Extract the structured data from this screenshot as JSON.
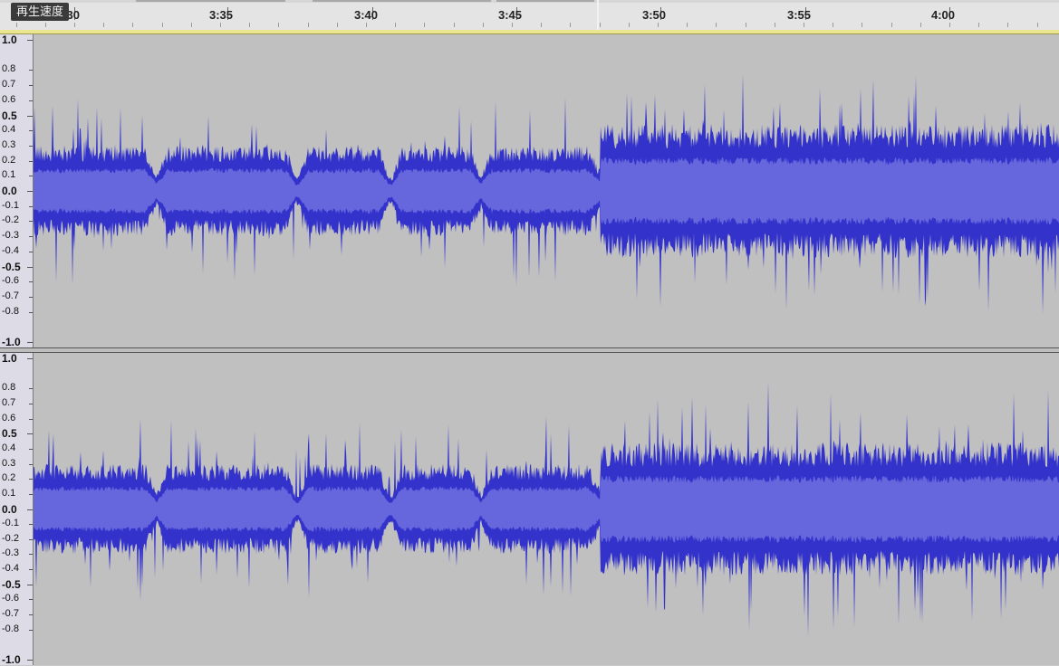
{
  "tooltip": "再生速度",
  "timeline": {
    "labels": [
      "3:30",
      "3:35",
      "3:40",
      "3:45",
      "3:50",
      "3:55",
      "4:00"
    ]
  },
  "tracks": [
    {
      "name": "left-channel",
      "scale_labels": [
        "1.0",
        "0.8",
        "0.7",
        "0.6",
        "0.5",
        "0.4",
        "0.3",
        "0.2",
        "0.1",
        "0.0",
        "-0.1",
        "-0.2",
        "-0.3",
        "-0.4",
        "-0.5",
        "-0.6",
        "-0.7",
        "-0.8",
        "-1.0"
      ]
    },
    {
      "name": "right-channel",
      "scale_labels": [
        "1.0",
        "0.8",
        "0.7",
        "0.6",
        "0.5",
        "0.4",
        "0.3",
        "0.2",
        "0.1",
        "0.0",
        "-0.1",
        "-0.2",
        "-0.3",
        "-0.4",
        "-0.5",
        "-0.6",
        "-0.7",
        "-0.8",
        "-1.0"
      ]
    }
  ],
  "colors": {
    "waveform_peak": "#3333cc",
    "waveform_rms": "#6666dd",
    "track_background": "#c0c0c0"
  }
}
